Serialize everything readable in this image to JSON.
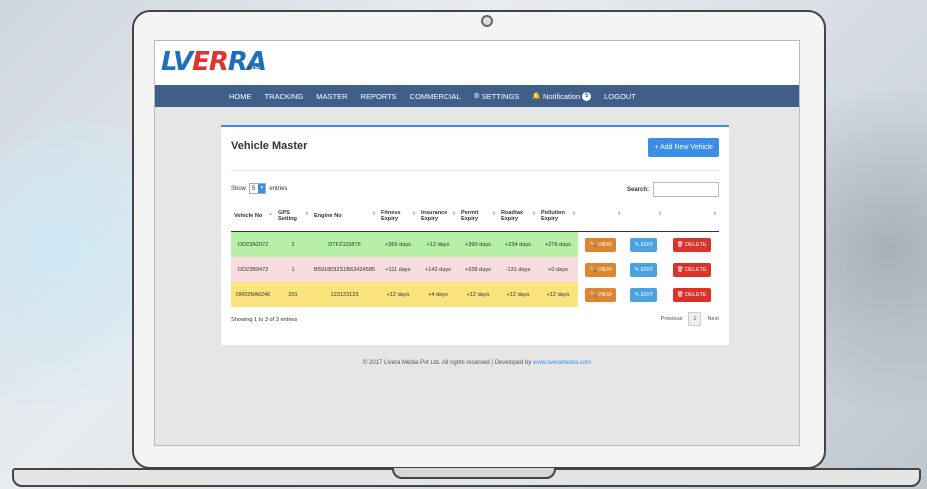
{
  "logo": {
    "mark_lv": "LV",
    "mark_er": "ER",
    "mark_ra": "RA",
    "sub": "TRACK"
  },
  "nav": {
    "items": [
      "HOME",
      "TRACKING",
      "MASTER",
      "REPORTS",
      "COMMERCIAL"
    ],
    "settings": "SETTINGS",
    "notifications": "Notification",
    "notification_count": "5",
    "logout": "LOGOUT"
  },
  "panel": {
    "title": "Vehicle Master",
    "add_button": "+ Add New Vehicle",
    "show_label": "Show",
    "entries_value": "5",
    "entries_label": "entries",
    "search_label": "Search:"
  },
  "table": {
    "headers": [
      "Vehicle No",
      "GPS Setting",
      "Engine No",
      "Fitness Expiry",
      "Insurance Expiry",
      "Permit Expiry",
      "Roadtax Expiry",
      "Pollution Expiry"
    ],
    "rows": [
      {
        "vehicle": "OD23A2072",
        "gps": "2",
        "engine": "DTFZ115876",
        "fitness": "+356 days",
        "insurance": "+12 days",
        "permit": "+390 days",
        "roadtax": "+234 days",
        "pollution": "+276 days"
      },
      {
        "vehicle": "OD23B9472",
        "gps": "1",
        "engine": "B5918032S1B63424585",
        "fitness": "+111 days",
        "insurance": "+142 days",
        "permit": "+938 days",
        "roadtax": "-131 days",
        "pollution": "+0 days"
      },
      {
        "vehicle": "OR02BA6246",
        "gps": "201",
        "engine": "123123123",
        "fitness": "+12 days",
        "insurance": "+4 days",
        "permit": "+12 days",
        "roadtax": "+12 days",
        "pollution": "+12 days"
      }
    ],
    "actions": {
      "view": "VIEW",
      "edit": "EDIT",
      "delete": "DELETE"
    }
  },
  "status": {
    "showing": "Showing 1 to 3 of 3 entries",
    "previous": "Previous",
    "page": "1",
    "next": "Next"
  },
  "footer": {
    "text": "© 2017 Livera Media Pvt Ltd. All rights reserved | Developed by ",
    "link": "www.liveramedia.com"
  }
}
